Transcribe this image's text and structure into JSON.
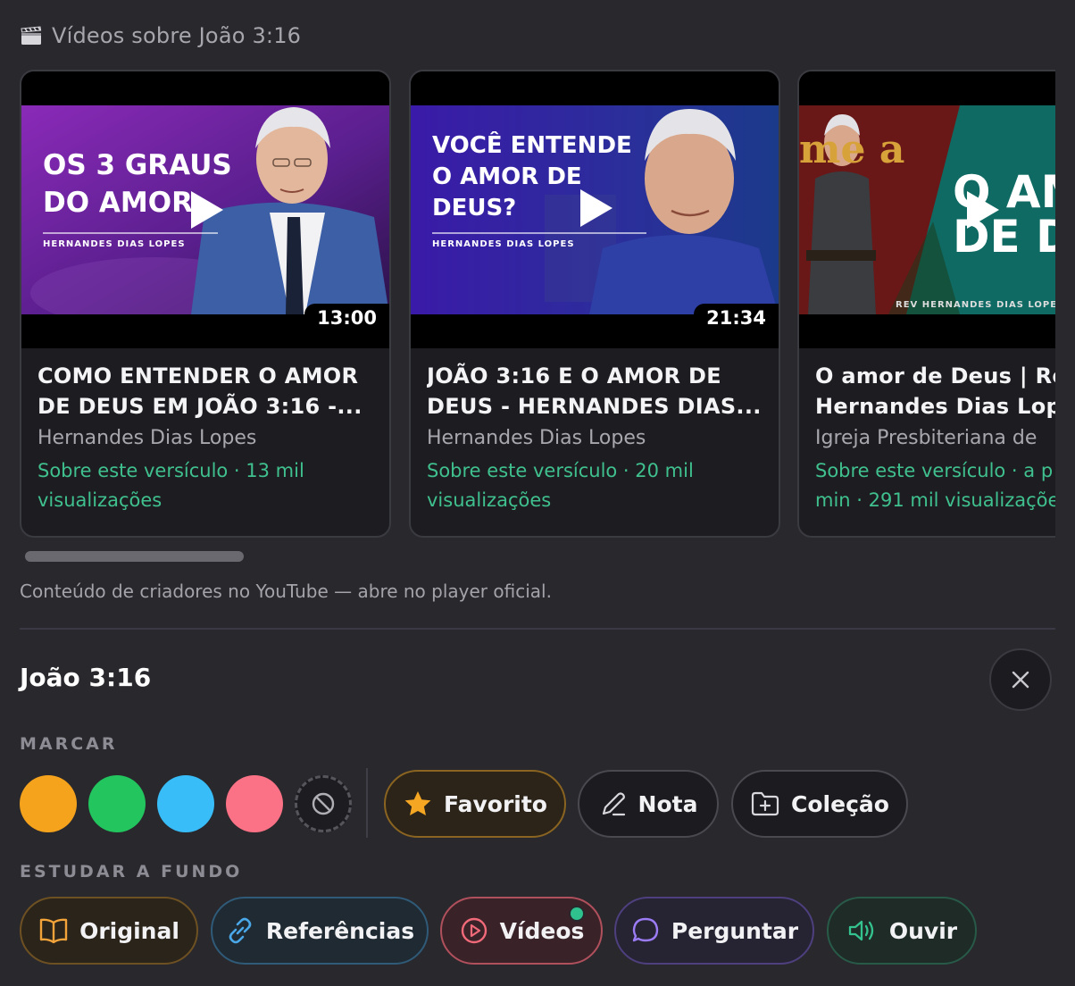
{
  "header": {
    "icon": "clapperboard-icon",
    "title": "Vídeos sobre João 3:16"
  },
  "videos": [
    {
      "thumb_headline": [
        "OS 3 GRAUS",
        "DO AMOR"
      ],
      "thumb_byline": "HERNANDES DIAS LOPES",
      "duration": "13:00",
      "title": "COMO ENTENDER O AMOR DE DEUS EM JOÃO 3:16 -...",
      "channel": "Hernandes Dias Lopes",
      "meta": "Sobre este versículo · 13 mil visualizações"
    },
    {
      "thumb_headline": [
        "VOCÊ ENTENDE",
        "O AMOR DE",
        "DEUS?"
      ],
      "thumb_byline": "HERNANDES DIAS LOPES",
      "duration": "21:34",
      "title": "JOÃO 3:16 E O AMOR DE DEUS - HERNANDES DIAS...",
      "channel": "Hernandes Dias Lopes",
      "meta": "Sobre este versículo · 20 mil visualizações"
    },
    {
      "thumb_headline": [
        "O AM",
        "DE D"
      ],
      "thumb_overlay": "me a",
      "thumb_byline": "REV HERNANDES DIAS LOPES",
      "title_line1": "O amor de Deus | Re",
      "title_line2": "Hernandes Dias Lop",
      "channel": "Igreja Presbiteriana de",
      "meta_line1": "Sobre este versículo · a p",
      "meta_line2": "min · 291 mil visualizaçõe"
    }
  ],
  "note": "Conteúdo de criadores no YouTube — abre no player oficial.",
  "verse": {
    "title": "João 3:16",
    "close_icon": "close-icon"
  },
  "marcar": {
    "label": "MARCAR",
    "colors": [
      "#f5a31c",
      "#22c55e",
      "#38bdf8",
      "#fb7185"
    ],
    "clear_icon": "ban-icon",
    "actions": [
      {
        "label": "Favorito",
        "icon": "star-icon",
        "accent": "#f5a623"
      },
      {
        "label": "Nota",
        "icon": "pencil-icon"
      },
      {
        "label": "Coleção",
        "icon": "folder-plus-icon"
      }
    ]
  },
  "estudar": {
    "label": "ESTUDAR A FUNDO",
    "actions": [
      {
        "label": "Original",
        "icon": "book-open-icon",
        "accent": "#f2a33a"
      },
      {
        "label": "Referências",
        "icon": "link-icon",
        "accent": "#4aa8e8"
      },
      {
        "label": "Vídeos",
        "icon": "play-circle-icon",
        "accent": "#f06a7a"
      },
      {
        "label": "Perguntar",
        "icon": "chat-bubble-icon",
        "accent": "#9b7cf5"
      },
      {
        "label": "Ouvir",
        "icon": "speaker-icon",
        "accent": "#34c38f"
      }
    ]
  }
}
